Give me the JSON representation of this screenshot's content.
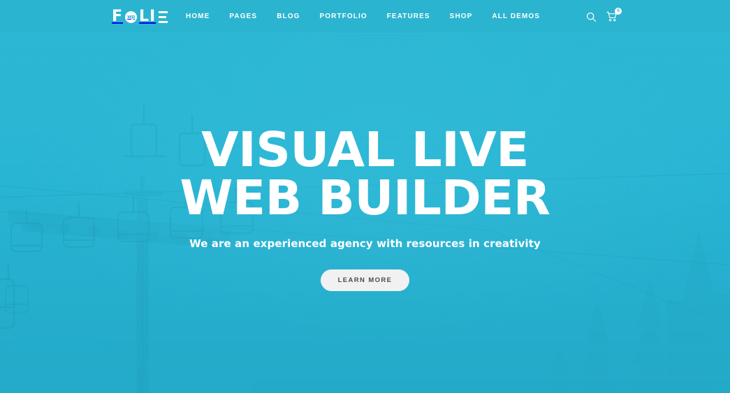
{
  "theme": {
    "brand_teal": "#29b5d4",
    "header_teal": "#2bb4d0",
    "button_bg": "#f1f1f1",
    "button_text": "#4b4b4b",
    "text_on_teal": "#ffffff"
  },
  "header": {
    "logo": {
      "text_before": "F",
      "circle_mark": "wp",
      "text_after": "LI",
      "final_letter": "E",
      "full_name": "FOLIE"
    },
    "nav": [
      {
        "label": "HOME"
      },
      {
        "label": "PAGES"
      },
      {
        "label": "BLOG"
      },
      {
        "label": "PORTFOLIO"
      },
      {
        "label": "FEATURES"
      },
      {
        "label": "SHOP"
      },
      {
        "label": "ALL DEMOS"
      }
    ],
    "actions": {
      "search_icon": "search-icon",
      "cart_icon": "shopping-cart-icon",
      "cart_count": "0"
    }
  },
  "hero": {
    "title_line_1": "VISUAL LIVE",
    "title_line_2": "WEB BUILDER",
    "subtitle": "We are an experienced agency with resources in creativity",
    "cta_label": "LEARN MORE",
    "background_scene": "ski-lift-chairlift-tower-with-pine-trees"
  }
}
